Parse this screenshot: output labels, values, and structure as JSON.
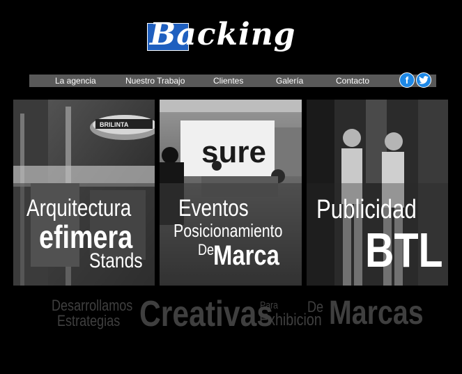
{
  "brand": {
    "logo_text": "Backing",
    "logo_letter": "B"
  },
  "nav": {
    "items": [
      "La agencia",
      "Nuestro Trabajo",
      "Clientes",
      "Galería",
      "Contacto"
    ]
  },
  "social": {
    "facebook": "f",
    "twitter": "t"
  },
  "panels": [
    {
      "line1": "Arquitectura",
      "line2": "efimera",
      "line3": "Stands",
      "sign": "BRILINTA"
    },
    {
      "line1": "Eventos",
      "line2": "Posicionamiento",
      "line3": "De",
      "line4": "Marca",
      "sign": "sure"
    },
    {
      "line1": "Publicidad",
      "line2": "BTL"
    }
  ],
  "tagline": {
    "w1": "Desarrollamos",
    "w2": "Estrategias",
    "w3": "Creativas",
    "w4": "Para",
    "w5": "Exhibicion",
    "w6": "De",
    "w7": "Marcas"
  },
  "colors": {
    "nav_bg": "#595959",
    "logo_blue": "#1f5fbf",
    "social_blue": "#1e88e5",
    "tagline": "#3f3f3f"
  }
}
